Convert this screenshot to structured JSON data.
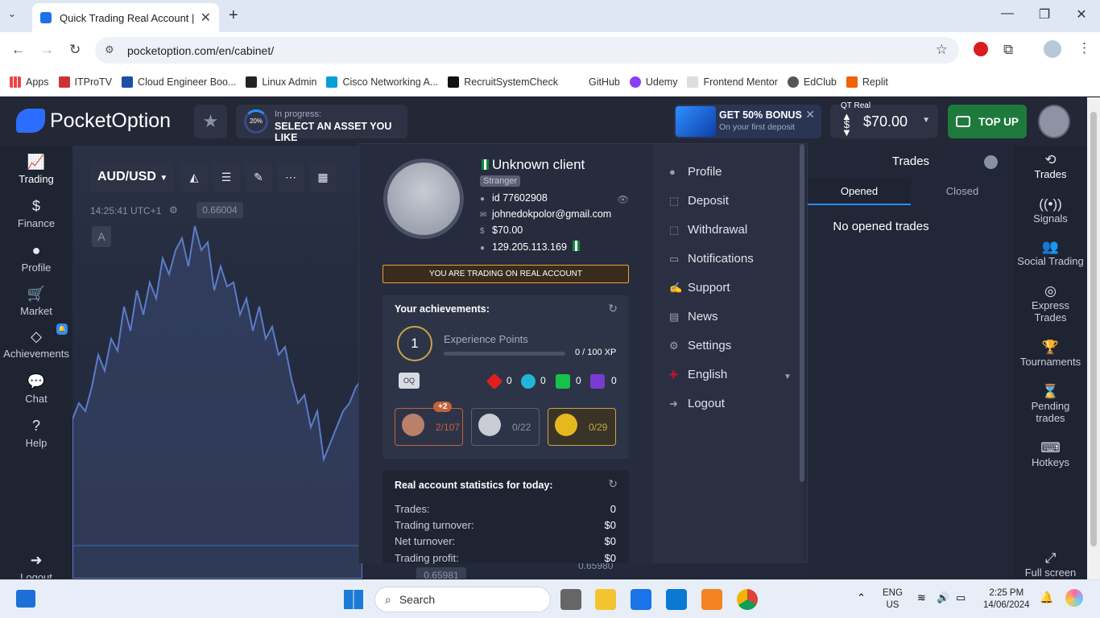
{
  "browser": {
    "tab_title": "Quick Trading Real Account | Po",
    "url": "pocketoption.com/en/cabinet/",
    "bookmarks": [
      "Apps",
      "ITProTV",
      "Cloud Engineer Boo...",
      "Linux Admin",
      "Cisco Networking A...",
      "RecruitSystemCheck",
      "GitHub",
      "Udemy",
      "Frontend Mentor",
      "EdClub",
      "Replit"
    ]
  },
  "header": {
    "logo_text": "PocketOption",
    "progress_label": "In progress:",
    "progress_value": "20%",
    "progress_text": "SELECT AN ASSET YOU LIKE",
    "bonus_title": "GET 50% BONUS",
    "bonus_subtitle": "On your first deposit",
    "account_type": "QT Real",
    "currency_symbol": "$",
    "balance": "$70.00",
    "topup_label": "TOP UP"
  },
  "leftnav": {
    "trading": "Trading",
    "finance": "Finance",
    "profile": "Profile",
    "market": "Market",
    "achievements": "Achievements",
    "chat": "Chat",
    "help": "Help",
    "logout": "Logout"
  },
  "chart": {
    "asset": "AUD/USD",
    "time": "14:25:41 UTC+1",
    "price_tag": "0.66004",
    "drawing_label": "A",
    "bottom_price": "0.65981",
    "bottom_price2": "0.65980"
  },
  "trades_panel": {
    "title": "Trades",
    "tab_opened": "Opened",
    "tab_closed": "Closed",
    "empty": "No opened trades"
  },
  "rightnav": {
    "trades": "Trades",
    "signals": "Signals",
    "social": "Social Trading",
    "express": "Express Trades",
    "tournaments": "Tournaments",
    "pending": "Pending trades",
    "hotkeys": "Hotkeys",
    "fullscreen": "Full screen"
  },
  "profile_menu": {
    "name": "Unknown client",
    "rank": "Stranger",
    "id": "id 77602908",
    "email": "johnedokpolor@gmail.com",
    "balance": "$70.00",
    "ip": "129.205.113.169",
    "real_notice": "YOU ARE TRADING ON REAL ACCOUNT",
    "achievements_title": "Your achievements:",
    "level": "1",
    "xp_label": "Experience Points",
    "xp_value": "0 / 100 XP",
    "xp_progress": 0,
    "coin_label": "OQ",
    "gems": [
      "0",
      "0",
      "0",
      "0"
    ],
    "medal_plus": "+2",
    "medals": [
      "2/107",
      "0/22",
      "0/29"
    ],
    "stats_title": "Real account statistics for today:",
    "stats": [
      {
        "label": "Trades:",
        "value": "0"
      },
      {
        "label": "Trading turnover:",
        "value": "$0"
      },
      {
        "label": "Net turnover:",
        "value": "$0"
      },
      {
        "label": "Trading profit:",
        "value": "$0"
      }
    ],
    "menu": [
      "Profile",
      "Deposit",
      "Withdrawal",
      "Notifications",
      "Support",
      "News",
      "Settings",
      "English",
      "Logout"
    ]
  },
  "taskbar": {
    "search": "Search",
    "lang1": "ENG",
    "lang2": "US",
    "time": "2:25 PM",
    "date": "14/06/2024"
  }
}
